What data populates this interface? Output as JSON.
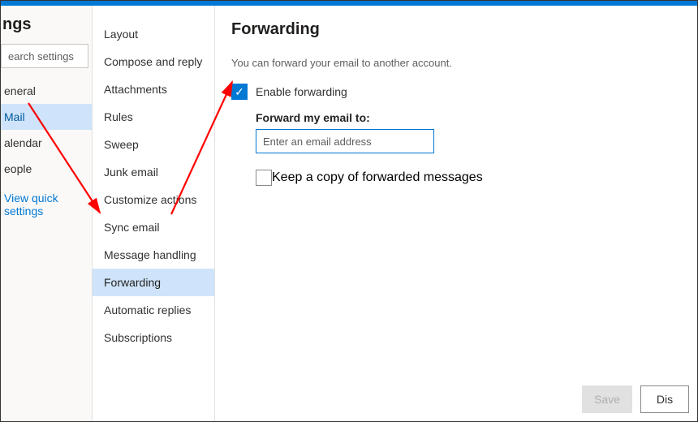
{
  "colors": {
    "accent": "#0078d4",
    "nav_active_bg": "#cfe4fa",
    "arrow": "#ff0000"
  },
  "nav1": {
    "title_fragment": "ngs",
    "search_placeholder": "earch settings",
    "items": [
      "eneral",
      "Mail",
      "alendar",
      "eople"
    ],
    "active_index": 1,
    "quick_link": "View quick settings"
  },
  "nav2": {
    "items": [
      "Layout",
      "Compose and reply",
      "Attachments",
      "Rules",
      "Sweep",
      "Junk email",
      "Customize actions",
      "Sync email",
      "Message handling",
      "Forwarding",
      "Automatic replies",
      "Subscriptions"
    ],
    "active_index": 9
  },
  "main": {
    "heading": "Forwarding",
    "description": "You can forward your email to another account.",
    "enable_label": "Enable forwarding",
    "enable_checked": true,
    "forward_to_label": "Forward my email to:",
    "email_placeholder": "Enter an email address",
    "email_value": "",
    "keep_copy_label": "Keep a copy of forwarded messages",
    "keep_copy_checked": false
  },
  "footer": {
    "save": "Save",
    "discard_fragment": "Dis"
  }
}
